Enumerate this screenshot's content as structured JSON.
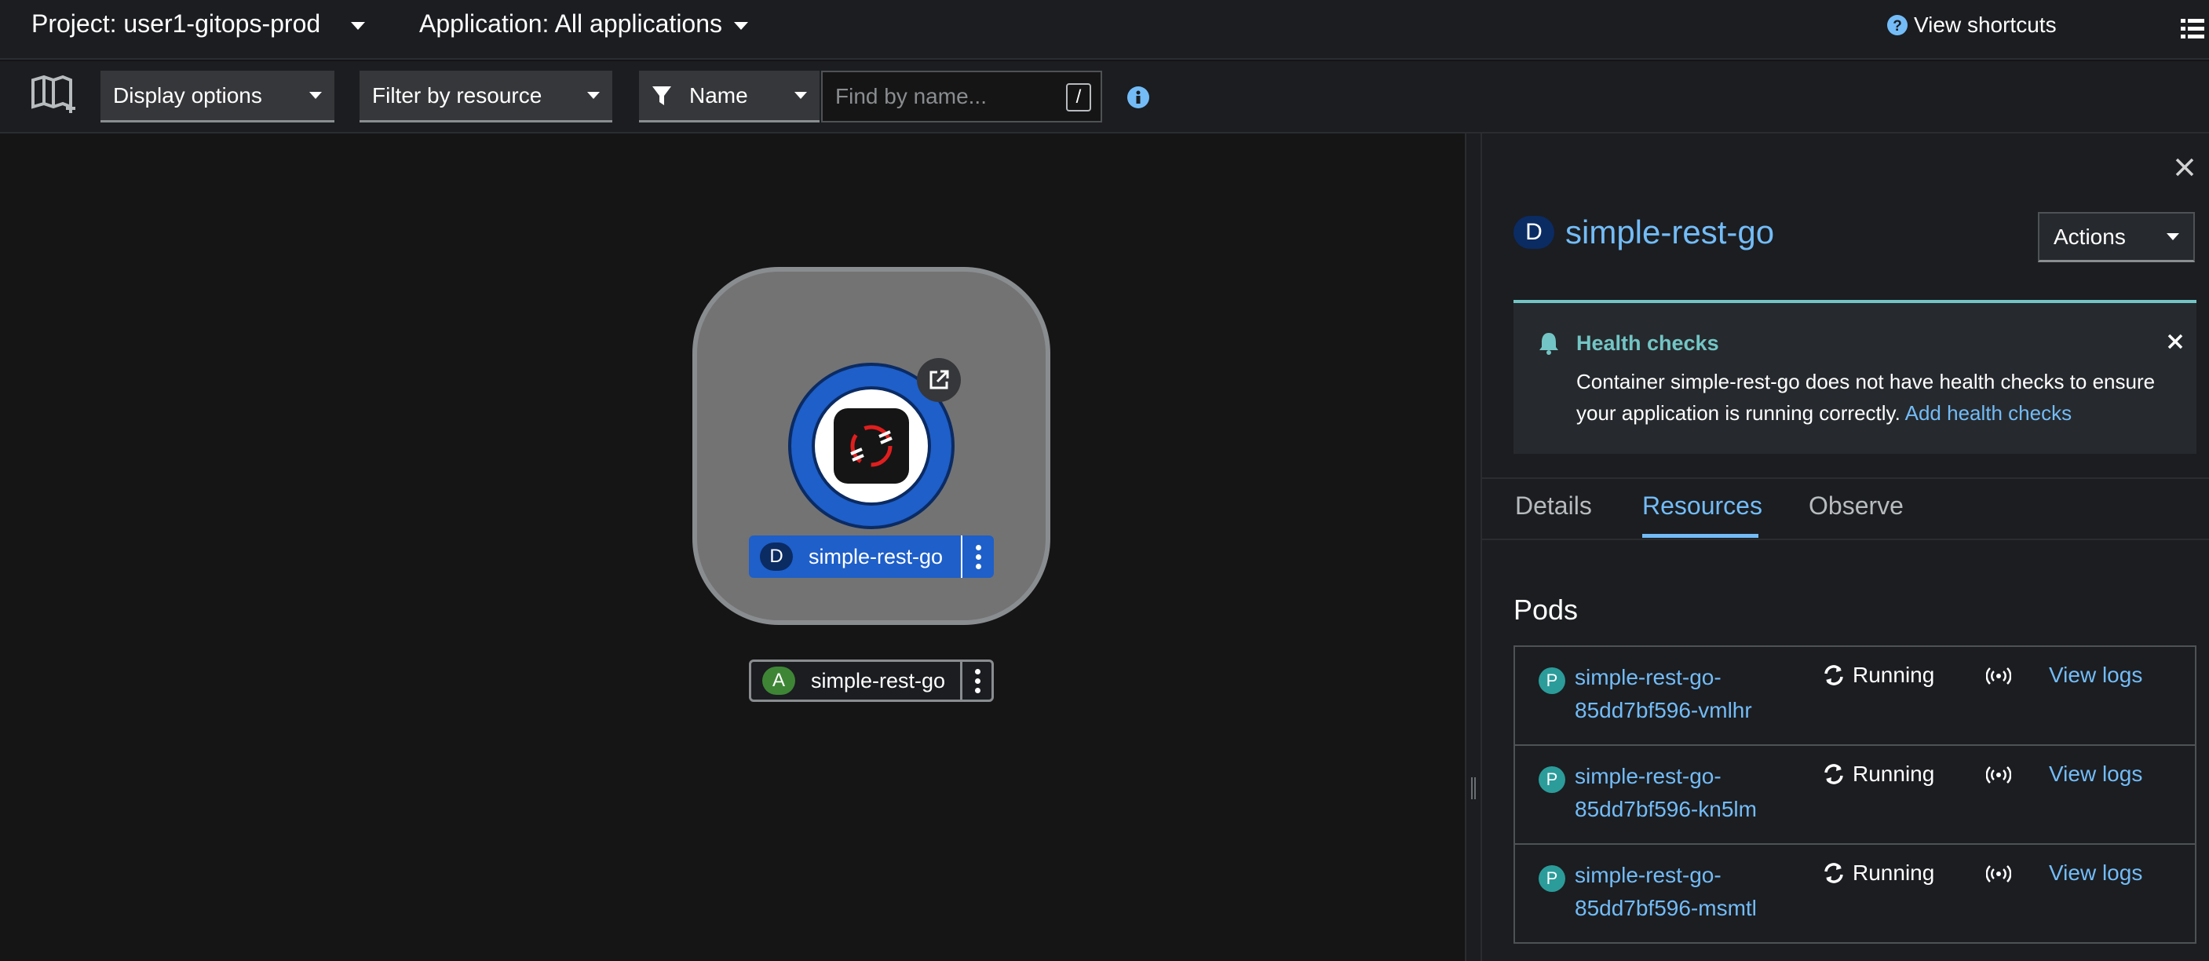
{
  "header": {
    "project_label": "Project: user1-gitops-prod",
    "application_label": "Application: All applications",
    "shortcuts_label": "View shortcuts"
  },
  "toolbar": {
    "display_options": "Display options",
    "filter_by_resource": "Filter by resource",
    "filter_type": "Name",
    "search_placeholder": "Find by name...",
    "search_shortcut": "/"
  },
  "topology": {
    "deployment": {
      "badge": "D",
      "name": "simple-rest-go"
    },
    "application": {
      "badge": "A",
      "name": "simple-rest-go"
    }
  },
  "panel": {
    "resource_badge": "D",
    "resource_name": "simple-rest-go",
    "actions_label": "Actions",
    "alert": {
      "title": "Health checks",
      "message": "Container simple-rest-go does not have health checks to ensure your application is running correctly.",
      "link": "Add health checks"
    },
    "tabs": [
      {
        "label": "Details",
        "active": false
      },
      {
        "label": "Resources",
        "active": true
      },
      {
        "label": "Observe",
        "active": false
      }
    ],
    "pods_heading": "Pods",
    "pods": [
      {
        "badge": "P",
        "name_line1": "simple-rest-go-",
        "name_line2": "85dd7bf596-vmlhr",
        "status": "Running",
        "logs": "View logs"
      },
      {
        "badge": "P",
        "name_line1": "simple-rest-go-",
        "name_line2": "85dd7bf596-kn5lm",
        "status": "Running",
        "logs": "View logs"
      },
      {
        "badge": "P",
        "name_line1": "simple-rest-go-",
        "name_line2": "85dd7bf596-msmtl",
        "status": "Running",
        "logs": "View logs"
      }
    ]
  },
  "colors": {
    "link": "#73bcf7",
    "deployment_blue": "#1e5fc9",
    "app_green": "#3e8635",
    "alert_teal": "#73c5c5",
    "pod_badge": "#2b9c9a"
  },
  "icons": [
    "topology-book-icon",
    "info-icon",
    "question-circle-icon",
    "list-view-icon",
    "close-icon",
    "bell-icon",
    "filter-icon",
    "external-link-icon",
    "sync-icon",
    "broadcast-icon",
    "kebab-icon"
  ]
}
